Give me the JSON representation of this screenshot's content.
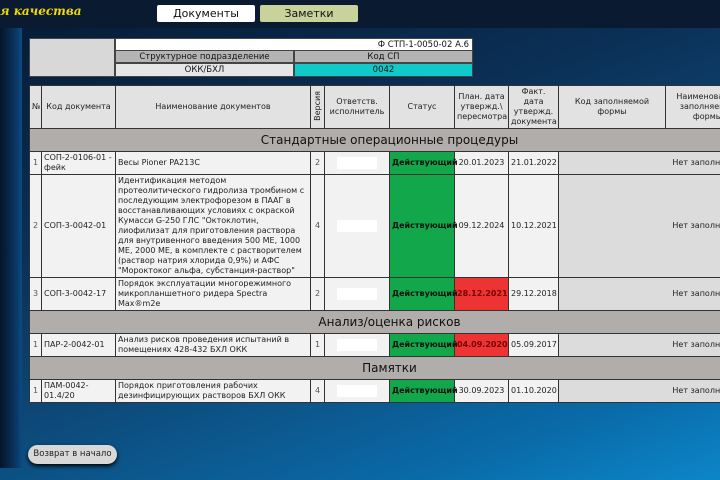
{
  "header": {
    "title": "я качества",
    "tabs": [
      {
        "label": "Документы"
      },
      {
        "label": "Заметки"
      }
    ]
  },
  "form_info": {
    "form_code": "Ф СТП-1-0050-02 А.6",
    "unit_label": "Структурное подразделение",
    "unit_value": "ОКК/БХЛ",
    "sp_label": "Код СП",
    "sp_value": "0042"
  },
  "columns": [
    "№",
    "Код документа",
    "Наименование документов",
    "Версия",
    "Ответств. исполнитель",
    "Статус",
    "План. дата утвержд.\\ пересмотра",
    "Факт. дата утвержд. документа",
    "Код заполняемой формы",
    "Наименование заполняемой формы"
  ],
  "sections": [
    {
      "title": "Стандартные операционные процедуры",
      "rows": [
        {
          "n": "1",
          "code": "СОП-2-0106-01 - фейк",
          "name": "Весы Pioner PA213C",
          "version": "2",
          "status": "Действующий",
          "plan": "20.01.2023",
          "plan_overdue": false,
          "fact": "21.01.2022",
          "form": "Нет заполняемых"
        },
        {
          "n": "2",
          "code": "СОП-3-0042-01",
          "name": "Идентификация методом протеолитического гидролиза тромбином с последующим электрофорезом в ПААГ в восстанавливающих условиях с окраской Кумасси G-250 ГЛС \"Октоклотин, лиофилизат для приготовления раствора для внутривенного введения 500 МЕ, 1000 МЕ, 2000 МЕ, в комплекте с растворителем (раствор натрия хлорида 0,9%) и АФС \"Мороктоког альфа, субстанция-раствор\"",
          "version": "4",
          "status": "Действующий",
          "plan": "09.12.2024",
          "plan_overdue": false,
          "fact": "10.12.2021",
          "form": "Нет заполняемых"
        },
        {
          "n": "3",
          "code": "СОП-3-0042-17",
          "name": "Порядок эксплуатации многорежимного микропланшетного ридера Spectra Max®m2e",
          "version": "2",
          "status": "Действующий",
          "plan": "28.12.2021",
          "plan_overdue": true,
          "fact": "29.12.2018",
          "form": "Нет заполняемых"
        }
      ]
    },
    {
      "title": "Анализ/оценка рисков",
      "rows": [
        {
          "n": "1",
          "code": "ПАР-2-0042-01",
          "name": "Анализ рисков проведения испытаний в помещениях 428-432 БХЛ ОКК",
          "version": "1",
          "status": "Действующий",
          "plan": "04.09.2020",
          "plan_overdue": true,
          "fact": "05.09.2017",
          "form": "Нет заполняемых"
        }
      ]
    },
    {
      "title": "Памятки",
      "rows": [
        {
          "n": "1",
          "code": "ПАМ-0042-01.4/20",
          "name": "Порядок приготовления рабочих дезинфицирующих растворов БХЛ ОКК",
          "version": "4",
          "status": "Действующий",
          "plan": "30.09.2023",
          "plan_overdue": false,
          "fact": "01.10.2020",
          "form": "Нет заполняемых"
        }
      ]
    }
  ],
  "footer": {
    "back_label": "Возврат в начало"
  }
}
